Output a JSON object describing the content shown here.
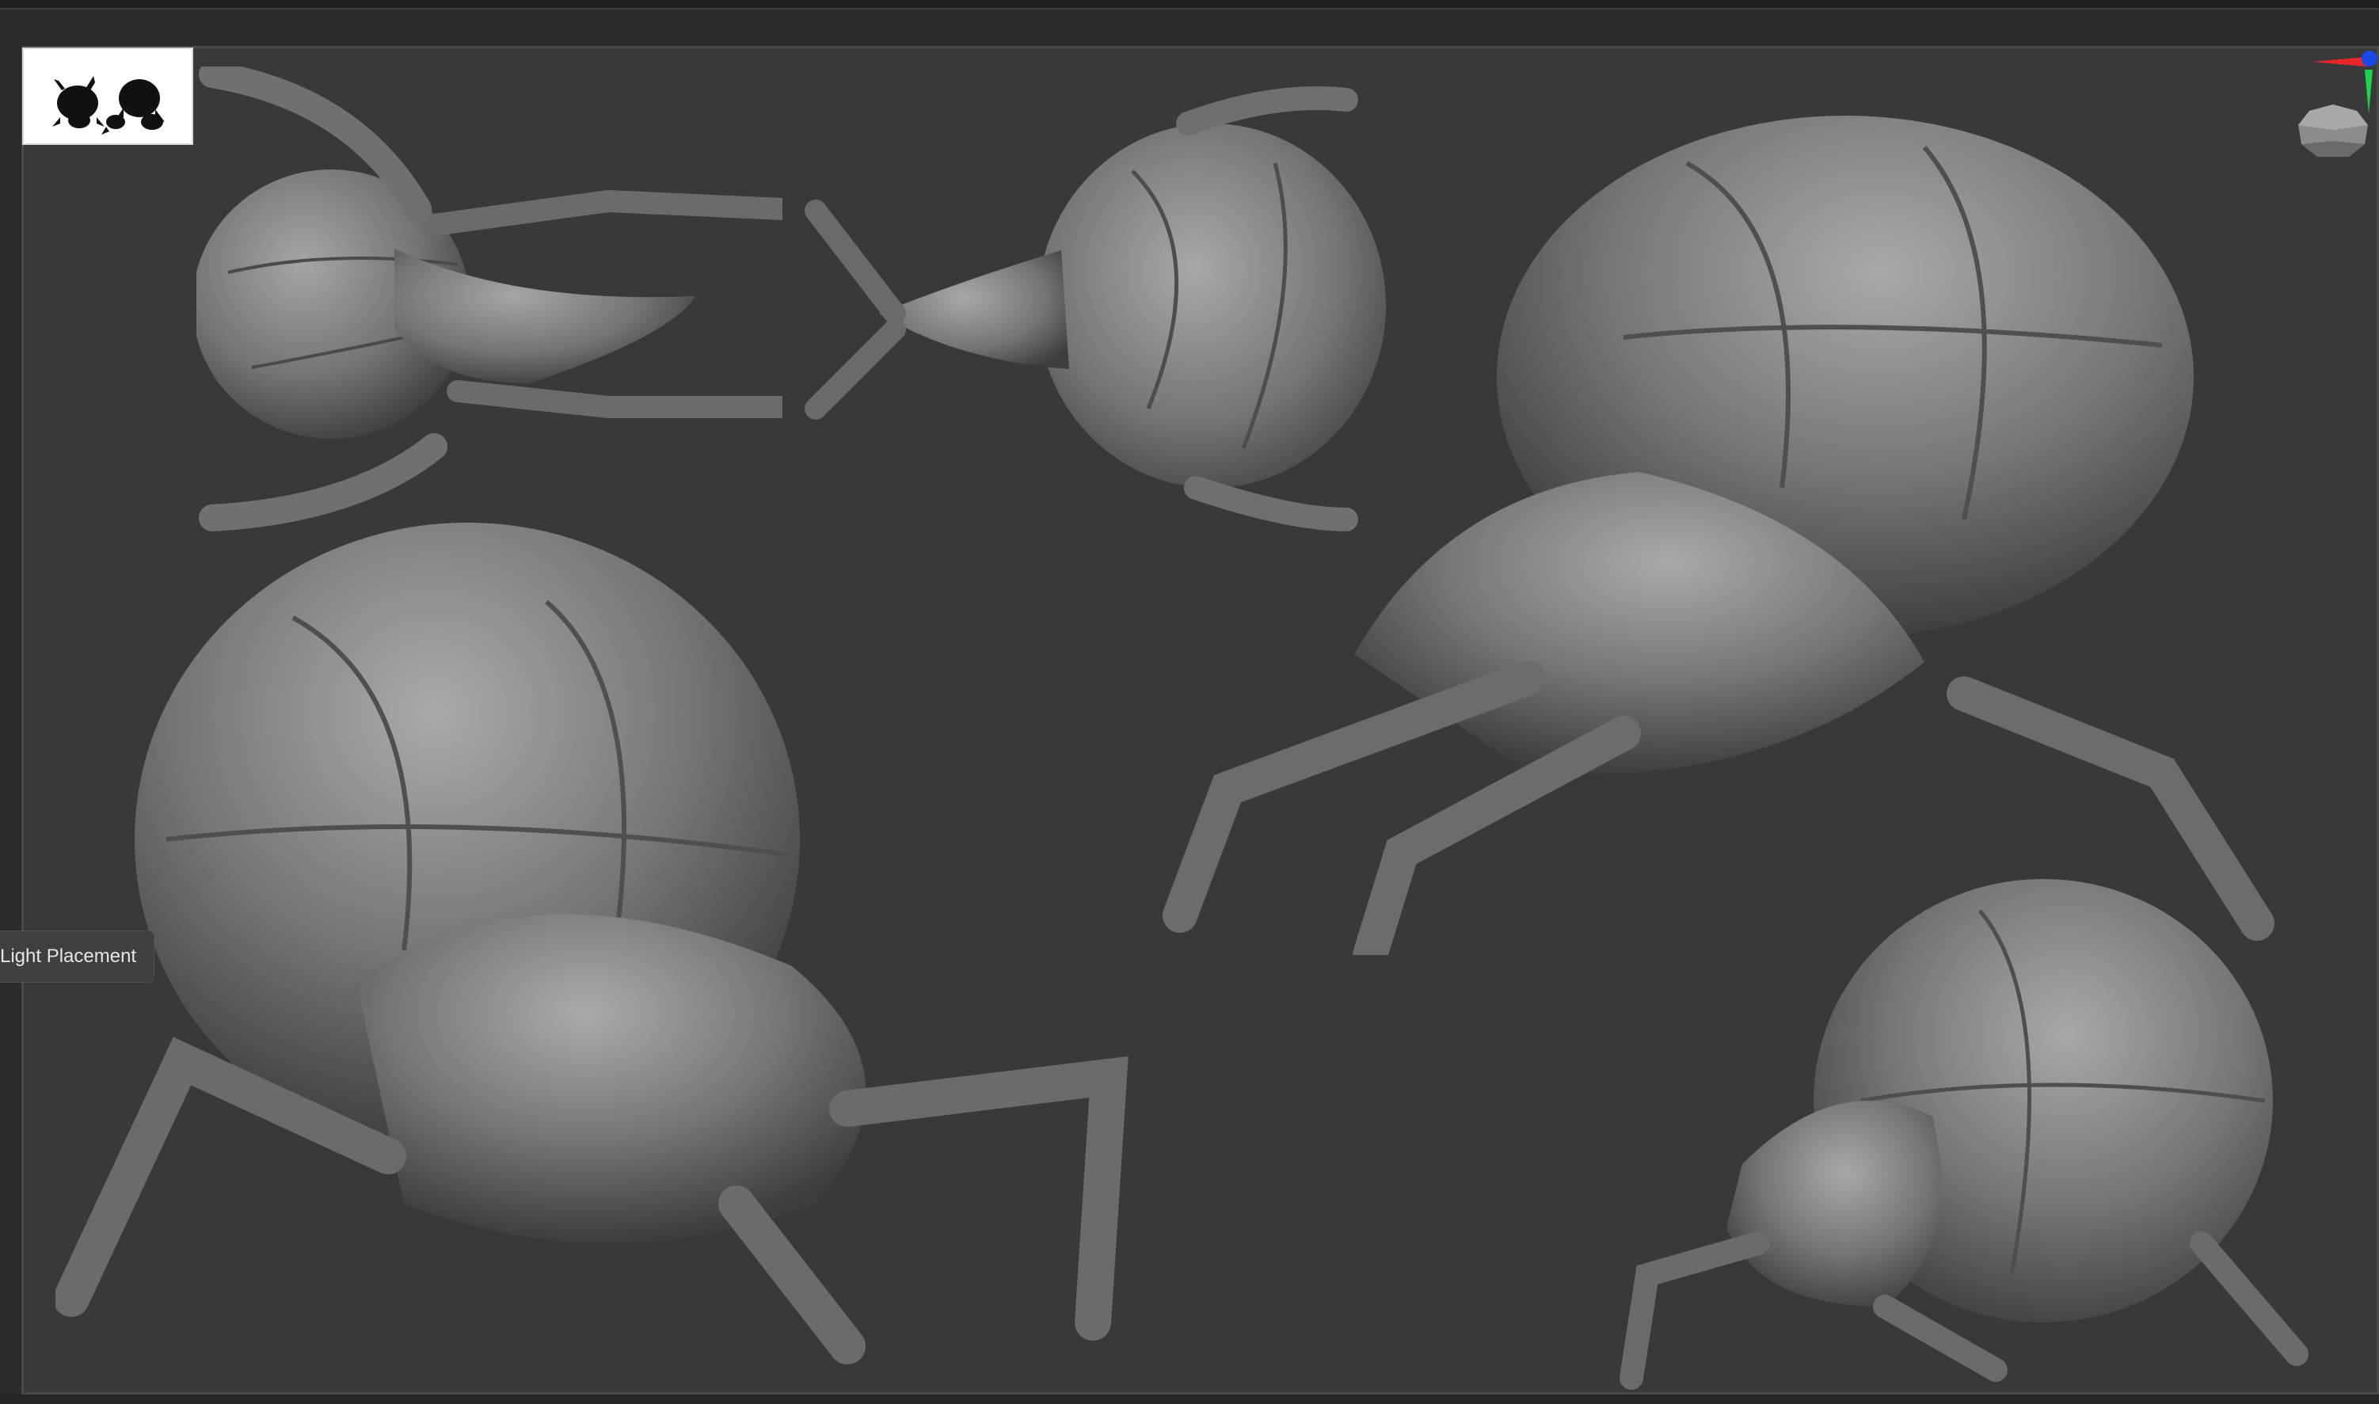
{
  "canvas": {
    "background": "#393939",
    "frame_color": "#4a4a4a"
  },
  "navigation_thumbnail": {
    "icon": "creature-silhouette-icon",
    "background": "#ffffff"
  },
  "axis_gizmo": {
    "icon": "axis-gizmo-icon",
    "x_color": "#e8262a",
    "y_color": "#1bd44a",
    "z_color": "#1848e6"
  },
  "tooltip": {
    "text": "Light Placement"
  },
  "model": {
    "icon": "sculpted-creature-icon",
    "views": [
      "top-view",
      "bottom-view",
      "three-quarter-front",
      "three-quarter-side",
      "rear-side-view"
    ],
    "material_color": "#7a7a7a"
  }
}
